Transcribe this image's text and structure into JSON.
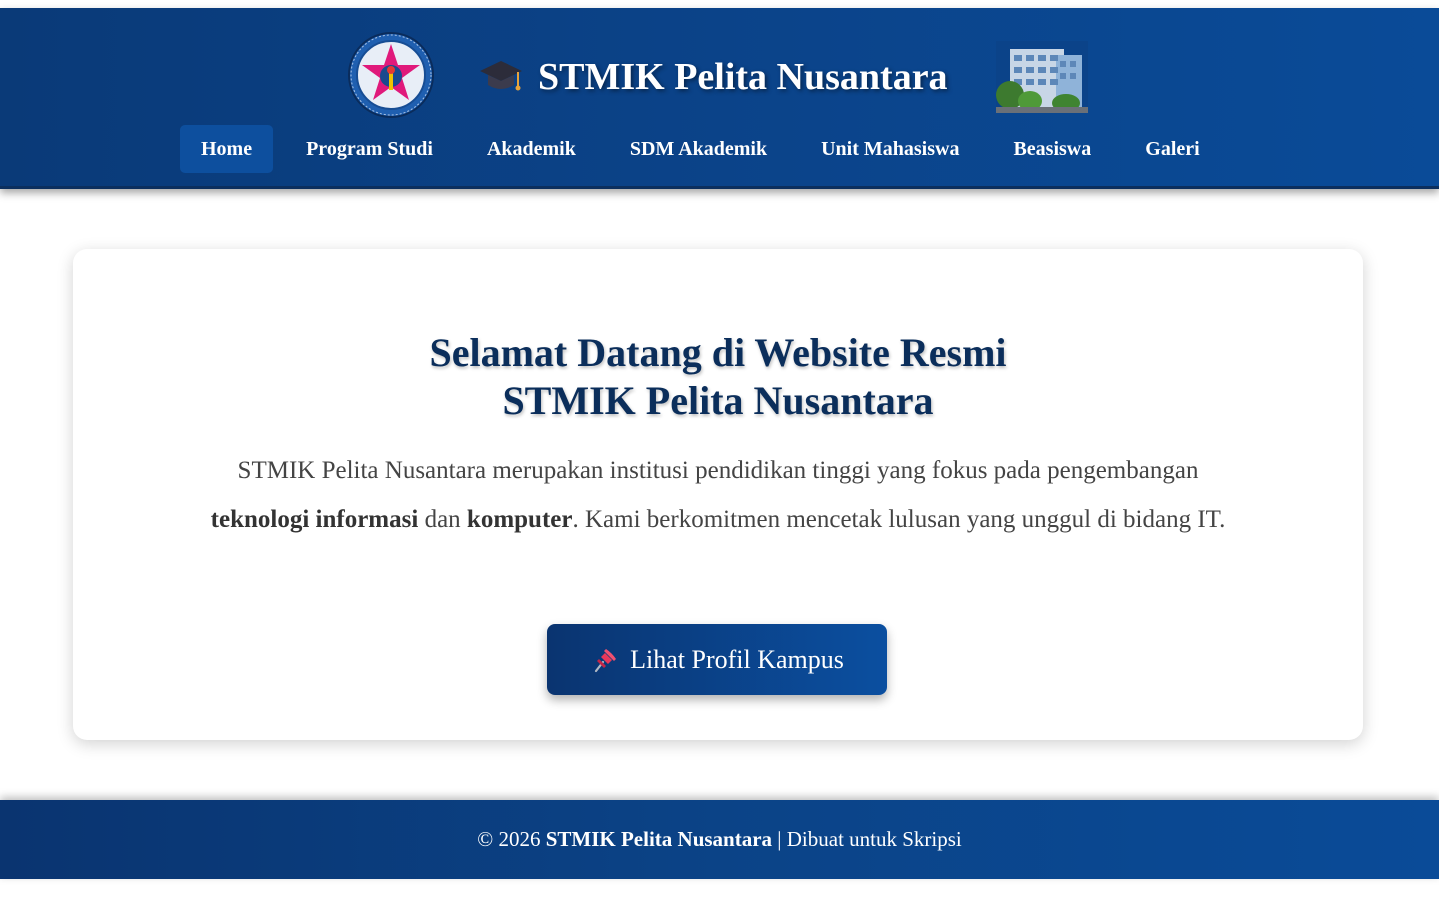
{
  "header": {
    "site_title": "STMIK Pelita Nusantara"
  },
  "nav": {
    "items": [
      {
        "label": "Home",
        "active": true
      },
      {
        "label": "Program Studi"
      },
      {
        "label": "Akademik"
      },
      {
        "label": "SDM Akademik"
      },
      {
        "label": "Unit Mahasiswa"
      },
      {
        "label": "Beasiswa"
      },
      {
        "label": "Galeri"
      }
    ]
  },
  "hero": {
    "title_line1": "Selamat Datang di Website Resmi",
    "title_line2": "STMIK Pelita Nusantara",
    "text_part1": "STMIK Pelita Nusantara merupakan institusi pendidikan tinggi yang fokus pada pengembangan ",
    "text_bold1": "teknologi informasi",
    "text_part2": " dan ",
    "text_bold2": "komputer",
    "text_part3": ". Kami berkomitmen mencetak lulusan yang unggul di bidang IT.",
    "cta_label": "Lihat Profil Kampus",
    "cta_icon": "pushpin-icon"
  },
  "footer": {
    "copyright": "© 2026",
    "name": "STMIK Pelita Nusantara",
    "suffix": "| Dibuat untuk Skripsi"
  },
  "colors": {
    "primary": "#0b4389",
    "title": "#0b2e5b",
    "text": "#444444"
  }
}
